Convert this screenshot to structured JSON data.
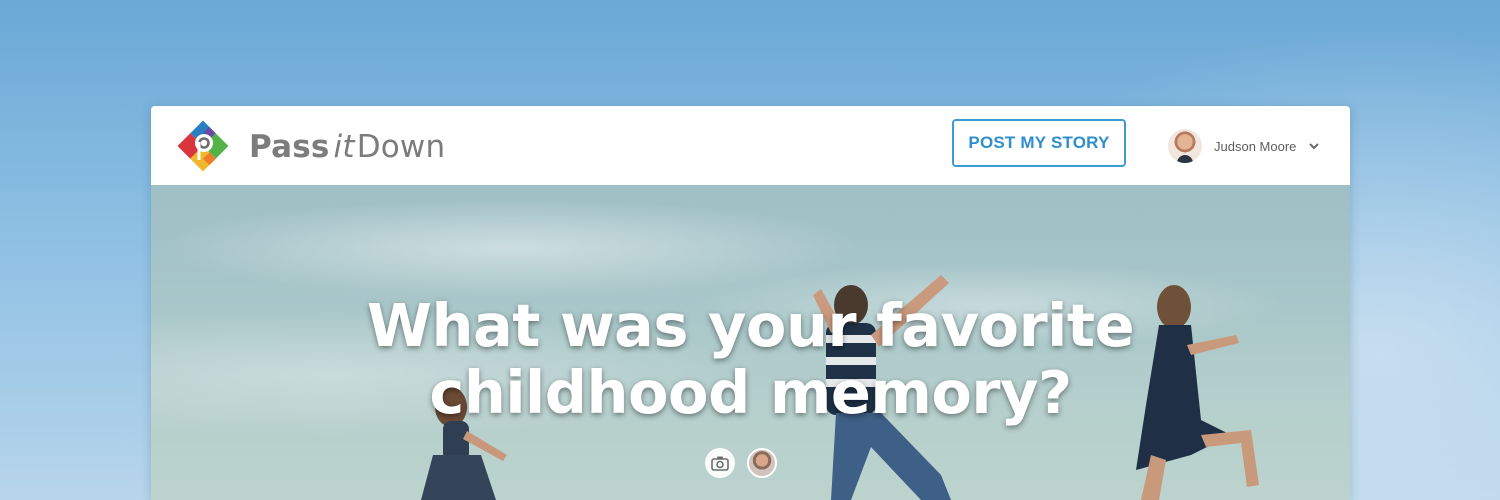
{
  "app": {
    "brand_part1": "Pass",
    "brand_part2": "it",
    "brand_part3": "Down",
    "logo_icon": "pass-it-down-logo"
  },
  "header": {
    "post_button_label": "POST MY STORY",
    "user_name": "Judson Moore",
    "user_menu_icon": "chevron-down-icon"
  },
  "hero": {
    "headline_line1": "What was your favorite",
    "headline_line2": "childhood memory?",
    "icons": [
      "camera-icon",
      "author-avatar"
    ]
  },
  "colors": {
    "accent": "#3d9cd5",
    "brand_text": "#7c7c7c",
    "background_sky": "#7ab3dc"
  }
}
